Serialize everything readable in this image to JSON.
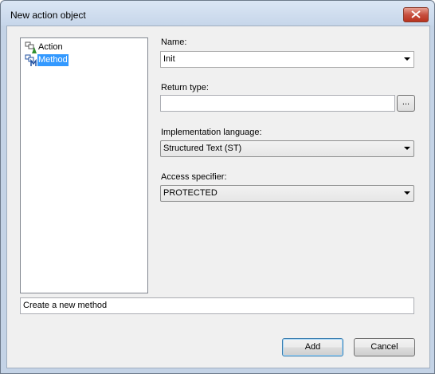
{
  "window": {
    "title": "New action object"
  },
  "tree": {
    "items": [
      {
        "label": "Action",
        "icon": "action-icon"
      },
      {
        "label": "Method",
        "icon": "method-icon",
        "selected": true
      }
    ]
  },
  "form": {
    "name_label": "Name:",
    "name_value": "Init",
    "return_type_label": "Return type:",
    "return_type_value": "",
    "browse_label": "...",
    "impl_lang_label": "Implementation language:",
    "impl_lang_value": "Structured Text (ST)",
    "access_label": "Access specifier:",
    "access_value": "PROTECTED"
  },
  "description": "Create a new method",
  "buttons": {
    "add": "Add",
    "cancel": "Cancel"
  },
  "colors": {
    "selection": "#3399ff",
    "close_button": "#c75040"
  }
}
